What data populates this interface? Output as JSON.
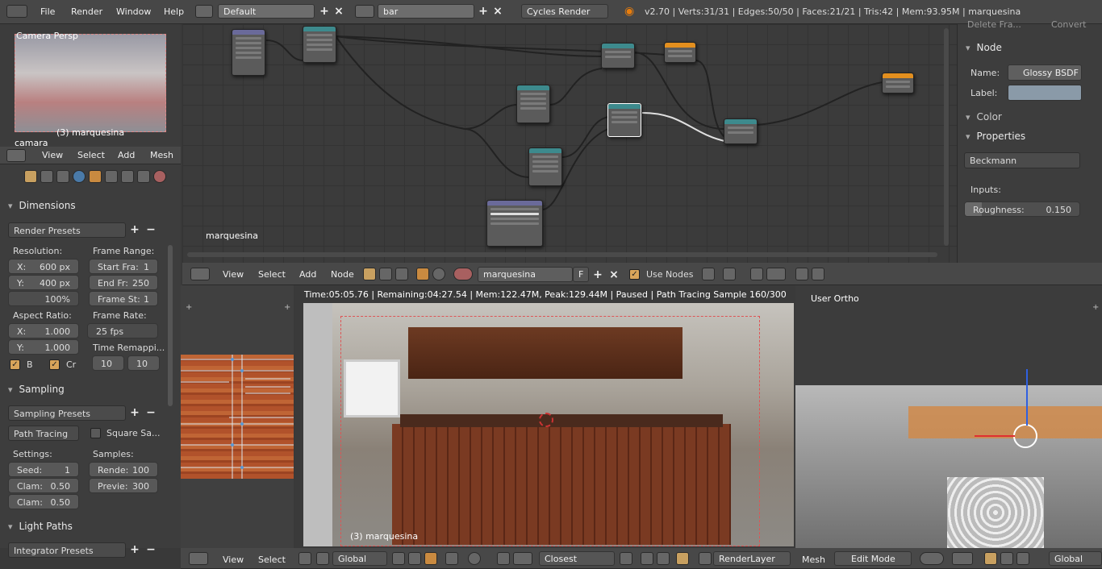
{
  "top": {
    "menus": [
      "File",
      "Render",
      "Window",
      "Help"
    ],
    "layout": "Default",
    "scene": "bar",
    "engine": "Cycles Render",
    "stats": "v2.70 | Verts:31/31 | Edges:50/50 | Faces:21/21 | Tris:42 | Mem:93.95M | marquesina"
  },
  "camview": {
    "label": "Camera Persp",
    "name": "(3) marquesina",
    "obj": "camara"
  },
  "view3d_hdr": {
    "menus": [
      "View",
      "Select",
      "Add",
      "Mesh"
    ]
  },
  "props": {
    "dimensions": "Dimensions",
    "render_presets": "Render Presets",
    "resolution": "Resolution:",
    "x_label": "X:",
    "x_val": "600 px",
    "y_label": "Y:",
    "y_val": "400 px",
    "pct": "100%",
    "frame_range": "Frame Range:",
    "start_label": "Start Fra:",
    "start_val": "1",
    "end_label": "End Fr:",
    "end_val": "250",
    "step_label": "Frame St:",
    "step_val": "1",
    "aspect": "Aspect Ratio:",
    "ax": "1.000",
    "ay": "1.000",
    "frame_rate": "Frame Rate:",
    "fps": "25 fps",
    "remap": "Time Remappi...",
    "remap_old": "10",
    "remap_new": "10",
    "b": "B",
    "cr": "Cr",
    "sampling": "Sampling",
    "sampling_presets": "Sampling Presets",
    "path_tracing": "Path Tracing",
    "square": "Square Sa...",
    "settings": "Settings:",
    "samples": "Samples:",
    "seed_label": "Seed:",
    "seed": "1",
    "render_label": "Rende:",
    "render_val": "100",
    "clam1_label": "Clam:",
    "clam1": "0.50",
    "preview_label": "Previe:",
    "preview_val": "300",
    "clam2_label": "Clam:",
    "clam2": "0.50",
    "light_paths": "Light Paths",
    "integrator": "Integrator Presets"
  },
  "nodeeditor": {
    "label": "marquesina",
    "menus": [
      "View",
      "Select",
      "Add",
      "Node"
    ],
    "material": "marquesina",
    "f": "F",
    "use_nodes": "Use Nodes"
  },
  "sidebar": {
    "top1": "Delete Fra...",
    "top2": "Convert",
    "node": "Node",
    "name_label": "Name:",
    "name_val": "Glossy BSDF",
    "label_label": "Label:",
    "color": "Color",
    "properties": "Properties",
    "distribution": "Beckmann",
    "inputs": "Inputs:",
    "roughness_label": "Roughness:",
    "roughness_val": "0.150",
    "roughness": 0.15
  },
  "render": {
    "status": "Time:05:05.76 | Remaining:04:27.54 | Mem:122.47M, Peak:129.44M | Paused | Path Tracing Sample 160/300",
    "name": "(3) marquesina"
  },
  "ortho": {
    "label": "User Ortho"
  },
  "bottom": {
    "view": "View",
    "select": "Select",
    "global": "Global",
    "closest": "Closest",
    "renderlayer": "RenderLayer",
    "mesh": "Mesh",
    "editmode": "Edit Mode",
    "global2": "Global"
  }
}
